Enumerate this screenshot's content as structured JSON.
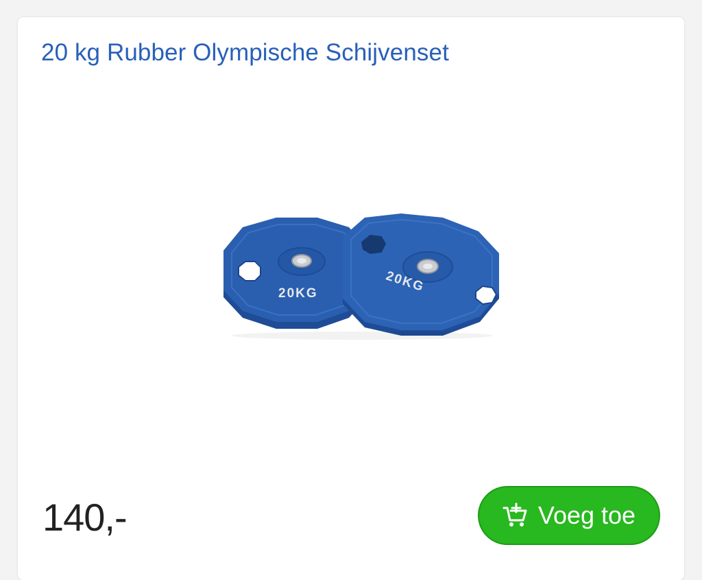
{
  "product": {
    "title": "20 kg Rubber Olympische Schijvenset",
    "image_name": "blue-rubber-olympic-plates",
    "plate_label": "20KG",
    "price": "140,-"
  },
  "cart_button": {
    "label": "Voeg toe",
    "icon": "add-to-cart-icon"
  },
  "colors": {
    "title": "#2860b8",
    "button": "#28b81f",
    "plate": "#2a5fb0"
  }
}
